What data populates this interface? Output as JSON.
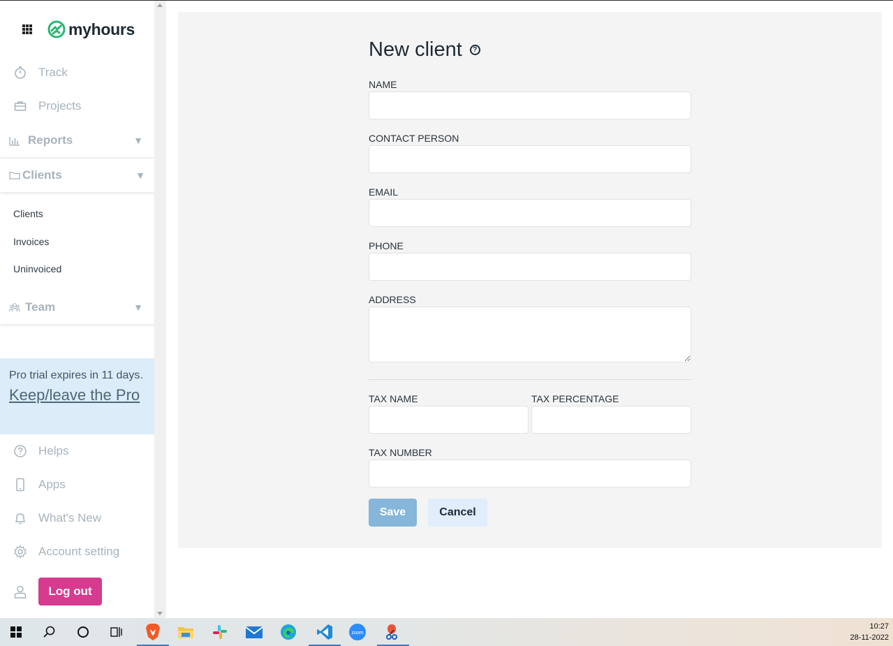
{
  "app": {
    "brand": "myhours"
  },
  "sidebar": {
    "nav_top": [
      {
        "label": "Track",
        "icon": "stopwatch-icon"
      },
      {
        "label": "Projects",
        "icon": "briefcase-icon"
      }
    ],
    "sections": {
      "reports": {
        "label": "Reports",
        "icon": "bar-chart-icon"
      },
      "clients": {
        "label": "Clients",
        "icon": "folder-icon"
      },
      "team": {
        "label": "Team",
        "icon": "team-icon"
      }
    },
    "client_subitems": [
      "Clients",
      "Invoices",
      "Uninvoiced"
    ],
    "promo": {
      "text": "Pro trial expires in 11 days.",
      "link": "Keep/leave the Pro"
    },
    "nav_bottom": [
      {
        "label": "Helps",
        "icon": "question-circle-icon"
      },
      {
        "label": "Apps",
        "icon": "phone-icon"
      },
      {
        "label": "What's New",
        "icon": "bell-icon"
      },
      {
        "label": "Account setting",
        "icon": "gear-icon"
      }
    ],
    "logout_label": "Log out"
  },
  "form": {
    "title": "New client",
    "help_glyph": "?",
    "labels": {
      "name": "NAME",
      "contact_person": "CONTACT PERSON",
      "email": "EMAIL",
      "phone": "PHONE",
      "address": "ADDRESS",
      "tax_name": "TAX NAME",
      "tax_percentage": "TAX PERCENTAGE",
      "tax_number": "TAX NUMBER"
    },
    "values": {
      "name": "",
      "contact_person": "",
      "email": "",
      "phone": "",
      "address": "",
      "tax_name": "",
      "tax_percentage": "",
      "tax_number": ""
    },
    "save_label": "Save",
    "cancel_label": "Cancel"
  },
  "taskbar": {
    "time": "10:27",
    "date": "28-11-2022"
  },
  "colors": {
    "accent_logout": "#d63b8f",
    "save_button": "#86b6d9",
    "cancel_button": "#dfeefa",
    "promo_bg": "#dcecf8",
    "brand_green": "#2bb673"
  }
}
